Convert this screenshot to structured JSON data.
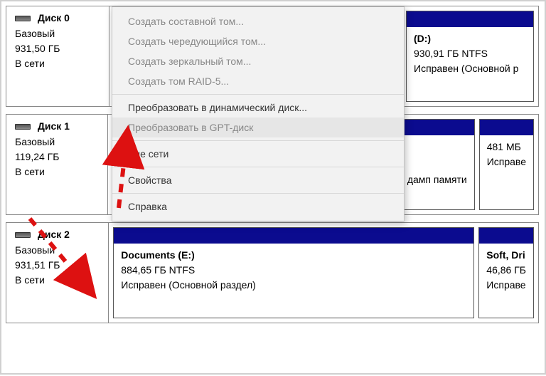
{
  "disks": [
    {
      "name": "Диск 0",
      "type": "Базовый",
      "size": "931,50 ГБ",
      "status": "В сети",
      "volumes": [
        {
          "name": "",
          "size_fs": "",
          "status": ""
        },
        {
          "name": "(D:)",
          "size_fs": "930,91 ГБ NTFS",
          "status": "Исправен (Основной р"
        }
      ]
    },
    {
      "name": "Диск 1",
      "type": "Базовый",
      "size": "119,24 ГБ",
      "status": "В сети",
      "volumes": [
        {
          "name": "",
          "size_fs": "",
          "status": "дамп памяти"
        },
        {
          "name": "",
          "size_fs": "481 МБ",
          "status": "Исправе"
        }
      ]
    },
    {
      "name": "Диск 2",
      "type": "Базовый",
      "size": "931,51 ГБ",
      "status": "В сети",
      "volumes": [
        {
          "name": "Documents  (E:)",
          "size_fs": "884,65 ГБ NTFS",
          "status": "Исправен (Основной раздел)"
        },
        {
          "name": "Soft, Dri",
          "size_fs": "46,86 ГБ",
          "status": "Исправе"
        }
      ]
    }
  ],
  "menu": {
    "items": [
      {
        "label": "Создать составной том...",
        "enabled": false
      },
      {
        "label": "Создать чередующийся том...",
        "enabled": false
      },
      {
        "label": "Создать зеркальный том...",
        "enabled": false
      },
      {
        "label": "Создать том RAID-5...",
        "enabled": false
      },
      {
        "sep": true
      },
      {
        "label": "Преобразовать в динамический диск...",
        "enabled": true
      },
      {
        "label": "Преобразовать в GPT-диск",
        "enabled": false,
        "hover": true
      },
      {
        "sep": true
      },
      {
        "label": "Вне сети",
        "enabled": true
      },
      {
        "sep": true
      },
      {
        "label": "Свойства",
        "enabled": true
      },
      {
        "sep": true
      },
      {
        "label": "Справка",
        "enabled": true
      }
    ]
  }
}
